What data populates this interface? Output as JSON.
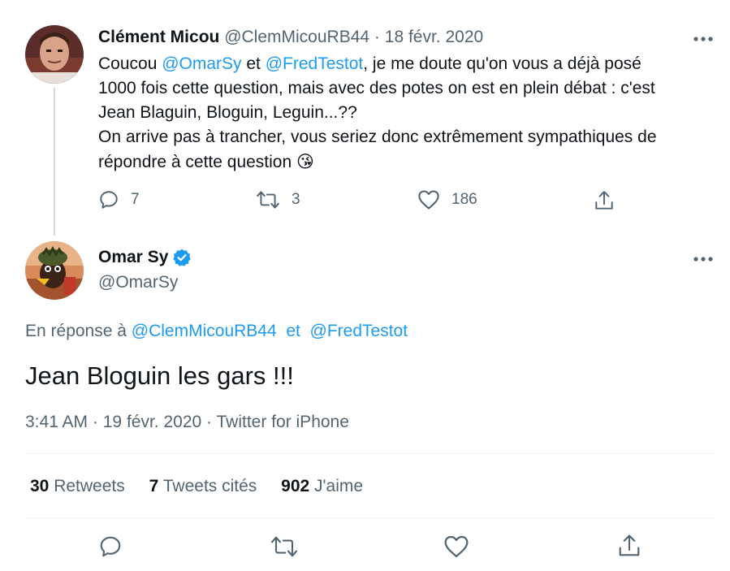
{
  "reply_to_tweet": {
    "display_name": "Clément Micou",
    "handle": "@ClemMicouRB44",
    "separator": "·",
    "date": "18 févr. 2020",
    "more_icon": "more-dots-icon",
    "text": {
      "p1": "Coucou ",
      "m1": "@OmarSy",
      "p2": " et ",
      "m2": "@FredTestot",
      "p3": ", je me doute qu'on vous a déjà posé",
      "line2": "1000 fois cette question, mais avec des potes on est en plein débat : c'est",
      "line3": "Jean Blaguin, Bloguin, Leguin...??",
      "line4": "On arrive pas à trancher, vous seriez donc extrêmement sympathiques de",
      "line5": "répondre à cette question ",
      "emoji": "😘"
    },
    "actions": {
      "replies": "7",
      "retweets": "3",
      "likes": "186"
    }
  },
  "main_tweet": {
    "display_name": "Omar Sy",
    "handle": "@OmarSy",
    "verified_icon": "verified-badge-icon",
    "reply_label": "En réponse à",
    "reply_mention1": "@ClemMicouRB44",
    "reply_and": "et",
    "reply_mention2": "@FredTestot",
    "text": "Jean Bloguin les gars !!!",
    "time": "3:41 AM",
    "separator": "·",
    "date": "19 févr. 2020",
    "source": "Twitter for iPhone",
    "stats": {
      "retweets_count": "30",
      "retweets_label": "Retweets",
      "quotes_count": "7",
      "quotes_label": "Tweets cités",
      "likes_count": "902",
      "likes_label": "J'aime"
    }
  },
  "colors": {
    "accent": "#1d9bf0",
    "muted": "#536471",
    "divider": "#eff3f4"
  }
}
